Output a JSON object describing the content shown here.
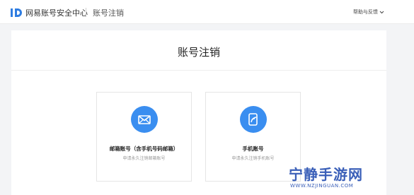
{
  "header": {
    "logo_text": "网易账号安全中心",
    "subtitle": "账号注销",
    "help_label": "帮助与反馈"
  },
  "card": {
    "title": "账号注销"
  },
  "options": [
    {
      "label": "邮箱账号（含手机号码邮箱）",
      "desc": "申请永久注销邮箱账号",
      "icon": "mail-icon"
    },
    {
      "label": "手机账号",
      "desc": "申请永久注销手机账号",
      "icon": "phone-account-icon"
    }
  ],
  "watermark": {
    "main": "宁静手游网",
    "sub": "WWW.NZJINGUAN.COM"
  },
  "colors": {
    "accent": "#3a8ef0",
    "logo_blue": "#2f7de1",
    "watermark": "#3a5fb8"
  }
}
